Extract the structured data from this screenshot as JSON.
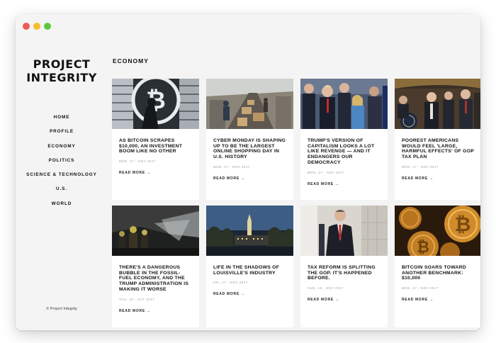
{
  "brand": {
    "line1": "PROJECT",
    "line2": "INTEGRITY",
    "copyright": "© Project Integrity"
  },
  "nav": [
    {
      "label": "HOME"
    },
    {
      "label": "PROFILE"
    },
    {
      "label": "ECONOMY"
    },
    {
      "label": "POLITICS"
    },
    {
      "label": "SCIENCE & TECHNOLOGY"
    },
    {
      "label": "U.S."
    },
    {
      "label": "WORLD"
    }
  ],
  "section": {
    "title": "ECONOMY"
  },
  "read_more_label": "READ MORE",
  "articles": [
    {
      "headline": "As Bitcoin Scrapes $10,000, an Investment Boom Like No Other",
      "date": "MON, 27 - NOV 2017",
      "image": "bitcoin-logo-photo"
    },
    {
      "headline": "Cyber Monday is shaping up to be the largest online shopping day in U.S. history",
      "date": "MON, 27 - NOV 2017",
      "image": "warehouse-photo"
    },
    {
      "headline": "Trump's version of capitalism looks a lot like revenge — and it endangers our democracy",
      "date": "MON, 27 - NOV 2017",
      "image": "politicians-crowd-photo"
    },
    {
      "headline": "Poorest Americans would feel 'large, harmful effects' of GOP tax plan",
      "date": "MON, 27 - NOV 2017",
      "image": "senators-podium-photo"
    },
    {
      "headline": "There's a dangerous bubble in the fossil-fuel economy, and the Trump administration is making it worse",
      "date": "THU, 13 - OCT 2017",
      "image": "coal-mine-photo"
    },
    {
      "headline": "Life in the Shadows of Louisville's Industry",
      "date": "FRI, 17 - NOV 2017",
      "image": "city-dusk-photo"
    },
    {
      "headline": "Tax reform is splitting the GOP. It's happened before.",
      "date": "SUN, 19 - NOV 2017",
      "image": "man-in-suit-photo"
    },
    {
      "headline": "Bitcoin soars toward another benchmark: $10,000",
      "date": "MON, 27 - NOV 2017",
      "image": "bitcoin-coins-photo"
    }
  ]
}
